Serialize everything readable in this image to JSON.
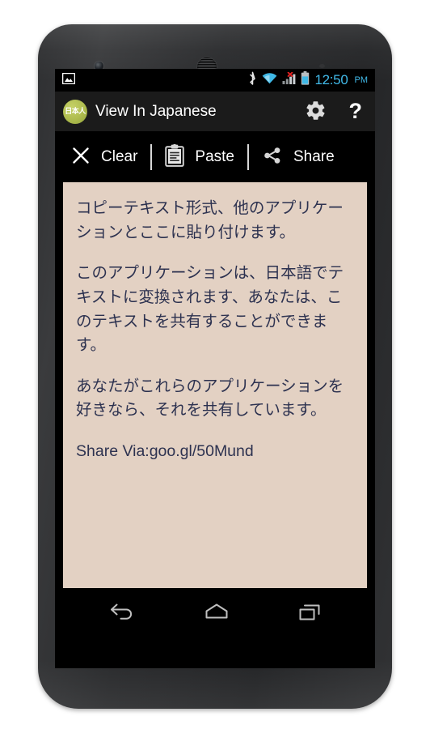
{
  "status_bar": {
    "notification_icon": "image-notification-icon",
    "icons": [
      "bluetooth-icon",
      "wifi-icon",
      "cellular-signal-no-service-icon",
      "battery-icon"
    ],
    "time": "12:50",
    "am_pm": "PM"
  },
  "app_bar": {
    "icon_badge_text": "日本人",
    "icon_badge_color": "#aebc4e",
    "title": "View In Japanese",
    "settings_icon": "gear-icon",
    "help_label": "?"
  },
  "toolbar": {
    "clear_label": "Clear",
    "clear_icon": "close-x-icon",
    "paste_label": "Paste",
    "paste_icon": "clipboard-icon",
    "share_label": "Share",
    "share_icon": "share-nodes-icon"
  },
  "text_panel": {
    "background_color": "#e3d1c3",
    "text_color": "#2d3250",
    "paragraphs": [
      "コピーテキスト形式、他のアプリケーションとここに貼り付けます。",
      "このアプリケーションは、日本語でテキストに変換されます、あなたは、このテキストを共有することができます。",
      "あなたがこれらのアプリケーションを好きなら、それを共有しています。",
      "Share Via:goo.gl/50Mund"
    ]
  },
  "nav_bar": {
    "back_icon": "back-arrow-icon",
    "home_icon": "home-icon",
    "recents_icon": "recent-apps-icon"
  }
}
